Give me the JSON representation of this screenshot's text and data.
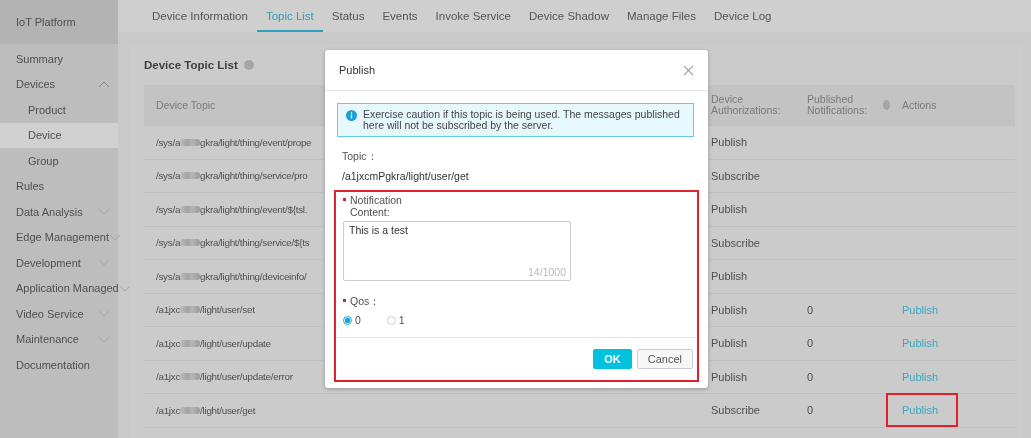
{
  "sidebar": {
    "title": "IoT Platform",
    "items": [
      {
        "label": "Summary",
        "selected": false
      },
      {
        "label": "Devices",
        "selected": false,
        "expanded": true,
        "children": [
          {
            "label": "Product",
            "selected": false
          },
          {
            "label": "Device",
            "selected": true
          },
          {
            "label": "Group",
            "selected": false
          }
        ]
      },
      {
        "label": "Rules",
        "selected": false
      },
      {
        "label": "Data Analysis",
        "selected": false,
        "expanded": false
      },
      {
        "label": "Edge Management",
        "selected": false,
        "expanded": false
      },
      {
        "label": "Development",
        "selected": false,
        "expanded": false
      },
      {
        "label": "Application Managed",
        "selected": false,
        "expanded": false
      },
      {
        "label": "Video Service",
        "selected": false,
        "expanded": false
      },
      {
        "label": "Maintenance",
        "selected": false,
        "expanded": false
      },
      {
        "label": "Documentation",
        "selected": false
      }
    ]
  },
  "tabs": [
    {
      "label": "Device Information",
      "selected": false
    },
    {
      "label": "Topic List",
      "selected": true
    },
    {
      "label": "Status",
      "selected": false
    },
    {
      "label": "Events",
      "selected": false
    },
    {
      "label": "Invoke Service",
      "selected": false
    },
    {
      "label": "Device Shadow",
      "selected": false
    },
    {
      "label": "Manage Files",
      "selected": false
    },
    {
      "label": "Device Log",
      "selected": false
    }
  ],
  "table": {
    "title": "Device Topic List",
    "columns": [
      "Device Topic",
      "Device Authorizations:",
      "Published Notifications:",
      "Actions"
    ],
    "rows": [
      {
        "topic_start": "/sys/a",
        "redacted": true,
        "topic_end": "gkra/light/thing/event/prope",
        "authorization": "Publish"
      },
      {
        "topic_start": "/sys/a",
        "redacted": true,
        "topic_end": "gkra/light/thing/service/pro",
        "authorization": "Subscribe"
      },
      {
        "topic_start": "/sys/a",
        "redacted": true,
        "topic_end": "gkra/light/thing/event/${tsl.",
        "authorization": "Publish"
      },
      {
        "topic_start": "/sys/a",
        "redacted": true,
        "topic_end": "gkra/light/thing/service/${ts",
        "authorization": "Subscribe"
      },
      {
        "topic_start": "/sys/a",
        "redacted": true,
        "topic_end": "gkra/light/thing/deviceinfo/",
        "authorization": "Publish"
      },
      {
        "topic_start": "/a1jxc",
        "redacted": true,
        "topic_end": "/light/user/set",
        "authorization": "Publish",
        "published": "0",
        "action": "Publish",
        "highlighted": false
      },
      {
        "topic_start": "/a1jxc",
        "redacted": true,
        "topic_end": "/light/user/update",
        "authorization": "Publish",
        "published": "0",
        "action": "Publish",
        "highlighted": false
      },
      {
        "topic_start": "/a1jxc",
        "redacted": true,
        "topic_end": "/light/user/update/error",
        "authorization": "Publish",
        "published": "0",
        "action": "Publish",
        "highlighted": false
      },
      {
        "topic_start": "/a1jxc",
        "redacted": true,
        "topic_end": "/light/user/get",
        "authorization": "Subscribe",
        "published": "0",
        "action": "Publish",
        "highlighted": true
      }
    ]
  },
  "dialog": {
    "title": "Publish",
    "alert": "Exercise caution if this topic is being used. The messages published here will not be subscribed by the server.",
    "topic_label": "Topic：",
    "topic": "/a1jxcmPgkra/light/user/get",
    "form_highlighted": true,
    "content_label": "Notification Content:",
    "content": "This is a test",
    "counter": "14/1000",
    "qos_label": "Qos：",
    "qos_options": [
      {
        "label": "0",
        "selected": true
      },
      {
        "label": "1",
        "selected": false
      }
    ],
    "buttons": [
      {
        "label": "OK",
        "kind": "primary"
      },
      {
        "label": "Cancel",
        "kind": "secondary"
      }
    ]
  }
}
